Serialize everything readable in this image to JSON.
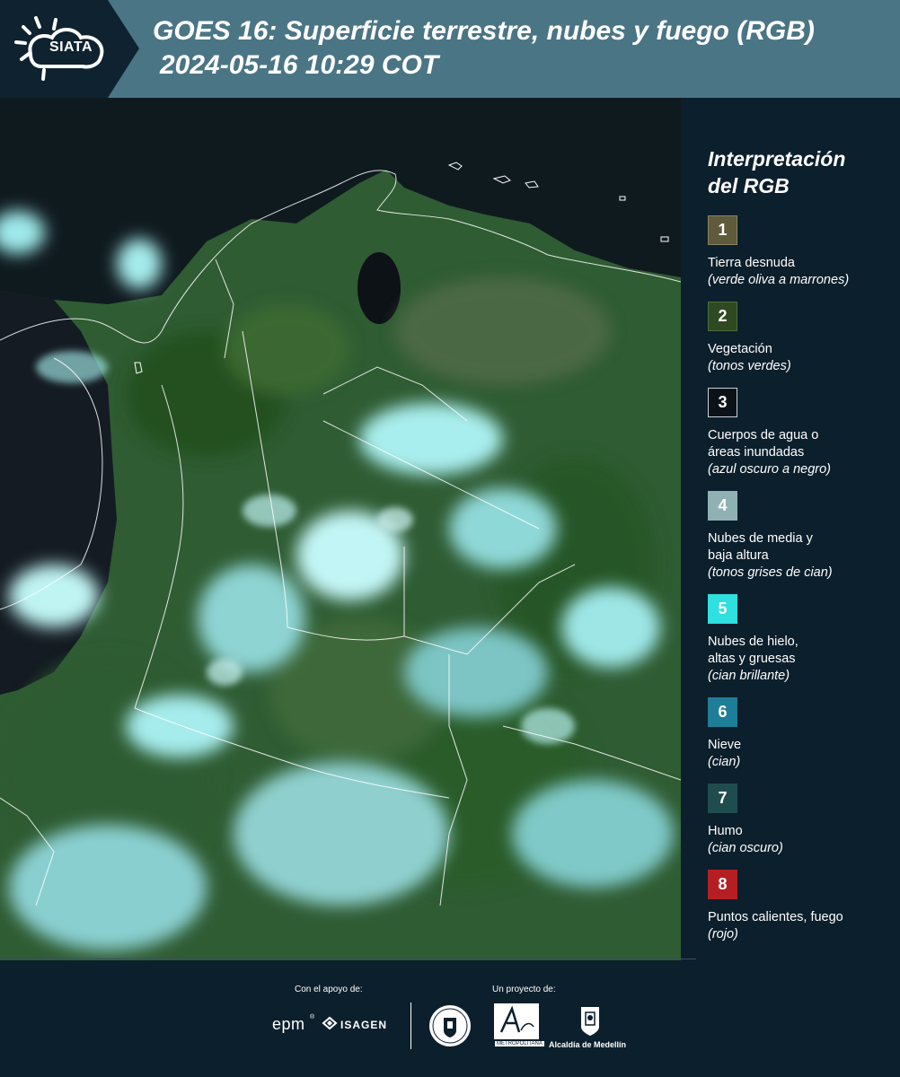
{
  "header": {
    "logo_text": "SIATA",
    "title_line1": "GOES 16: Superficie terrestre, nubes y fuego (RGB)",
    "title_line2": "2024-05-16 10:29 COT"
  },
  "legend": {
    "title_line1": "Interpretación",
    "title_line2": "del RGB",
    "items": [
      {
        "number": "1",
        "color": "#5e5a3c",
        "label": [
          "Tierra desnuda"
        ],
        "desc": "(verde oliva a marrones)"
      },
      {
        "number": "2",
        "color": "#2f4a22",
        "label": [
          "Vegetación"
        ],
        "desc": "(tonos verdes)"
      },
      {
        "number": "3",
        "color": "#0b1218",
        "label": [
          "Cuerpos de agua o",
          "áreas inundadas"
        ],
        "desc": "(azul oscuro a negro)"
      },
      {
        "number": "4",
        "color": "#8fb1b3",
        "label": [
          "Nubes de media y",
          "baja altura"
        ],
        "desc": "(tonos grises de cian)"
      },
      {
        "number": "5",
        "color": "#2ee0df",
        "label": [
          "Nubes de hielo,",
          "altas y gruesas"
        ],
        "desc": "(cian brillante)"
      },
      {
        "number": "6",
        "color": "#1e7e98",
        "label": [
          "Nieve"
        ],
        "desc": "(cian)"
      },
      {
        "number": "7",
        "color": "#1f4c4e",
        "label": [
          "Humo"
        ],
        "desc": "(cian oscuro)"
      },
      {
        "number": "8",
        "color": "#b51f24",
        "label": [
          "Puntos calientes, fuego"
        ],
        "desc": "(rojo)"
      }
    ]
  },
  "footer": {
    "support_caption": "Con el apoyo de:",
    "project_caption": "Un proyecto de:",
    "sponsors": [
      "epm",
      "ISAGEN"
    ],
    "partners": [
      "METROPOLITANA",
      "Alcaldía de Medellín"
    ]
  }
}
